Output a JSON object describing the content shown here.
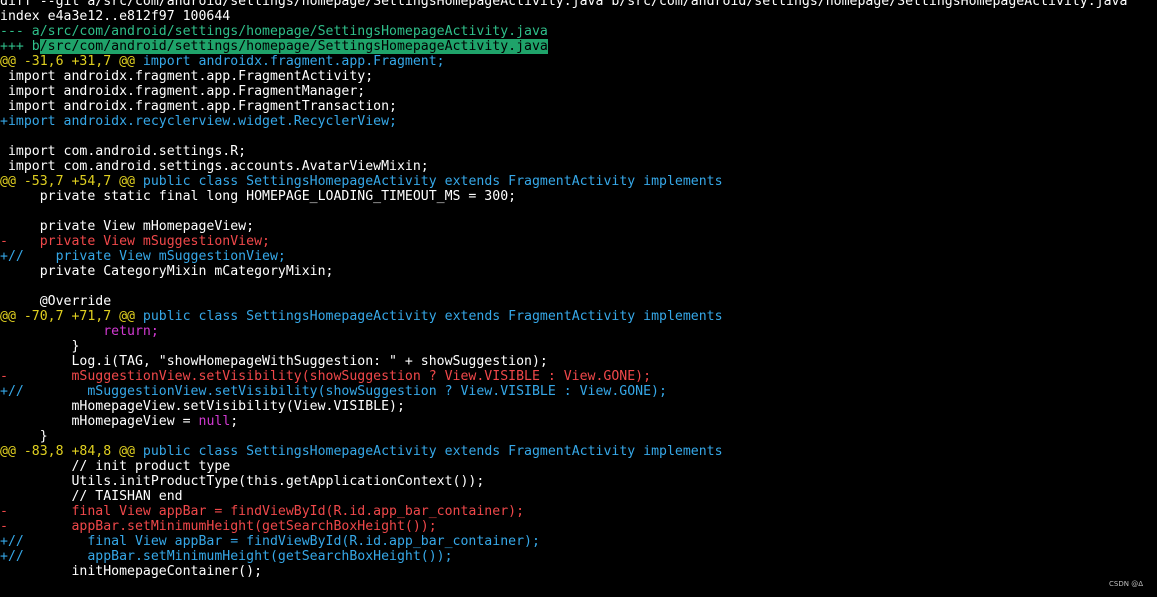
{
  "terminal": {
    "lines": [
      [
        [
          "diff --git a/src/com/android/settings/homepage/SettingsHomepageActivity.java b/src/com/android/settings/homepage/SettingsHomepageActivity.java",
          "white"
        ]
      ],
      [
        [
          "index e4a3e12..e812f97 100644",
          "white"
        ]
      ],
      [
        [
          "--- a",
          "green"
        ],
        [
          "/src/com/android/settings/homepage/SettingsHomepageActivity.java",
          "green"
        ]
      ],
      [
        [
          "+++ b",
          "green"
        ],
        [
          "/src/com/android/settings/homepage/SettingsHomepageActivity.java",
          "hl"
        ]
      ],
      [
        [
          "@@ -31,6 +31,7 @@",
          "yellow"
        ],
        [
          " import androidx.fragment.app.Fragment;",
          "cyan"
        ]
      ],
      [
        [
          " import androidx.fragment.app.FragmentActivity;",
          "white"
        ]
      ],
      [
        [
          " import androidx.fragment.app.FragmentManager;",
          "white"
        ]
      ],
      [
        [
          " import androidx.fragment.app.FragmentTransaction;",
          "white"
        ]
      ],
      [
        [
          "+import androidx.recyclerview.widget.RecyclerView;",
          "cyan"
        ]
      ],
      [
        [
          "",
          "white"
        ]
      ],
      [
        [
          " import com.android.settings.R;",
          "white"
        ]
      ],
      [
        [
          " import com.android.settings.accounts.AvatarViewMixin;",
          "white"
        ]
      ],
      [
        [
          "@@ -53,7 +54,7 @@",
          "yellow"
        ],
        [
          " public class ",
          "cyan"
        ],
        [
          "SettingsHomepageActivity",
          "cyan"
        ],
        [
          " extends ",
          "cyan"
        ],
        [
          "FragmentActivity",
          "cyan"
        ],
        [
          " implements",
          "cyan"
        ]
      ],
      [
        [
          "     private static final long HOMEPAGE_LOADING_TIMEOUT_MS = 300;",
          "white"
        ]
      ],
      [
        [
          "",
          "white"
        ]
      ],
      [
        [
          "     private View mHomepageView;",
          "white"
        ]
      ],
      [
        [
          "-    private View mSuggestionView;",
          "red"
        ]
      ],
      [
        [
          "+//    private View mSuggestionView;",
          "cyan"
        ]
      ],
      [
        [
          "     private CategoryMixin mCategoryMixin;",
          "white"
        ]
      ],
      [
        [
          "",
          "white"
        ]
      ],
      [
        [
          "     @Override",
          "white"
        ]
      ],
      [
        [
          "@@ -70,7 +71,7 @@",
          "yellow"
        ],
        [
          " public class ",
          "cyan"
        ],
        [
          "SettingsHomepageActivity",
          "cyan"
        ],
        [
          " extends ",
          "cyan"
        ],
        [
          "FragmentActivity",
          "cyan"
        ],
        [
          " implements",
          "cyan"
        ]
      ],
      [
        [
          "             ",
          "white"
        ],
        [
          "return;",
          "magenta"
        ]
      ],
      [
        [
          "         }",
          "white"
        ]
      ],
      [
        [
          "         Log.i(TAG, \"showHomepageWithSuggestion: \" + showSuggestion);",
          "white"
        ]
      ],
      [
        [
          "-        mSuggestionView.setVisibility(showSuggestion ? View.VISIBLE : View.GONE);",
          "red"
        ]
      ],
      [
        [
          "+//        mSuggestionView.setVisibility(showSuggestion ? View.VISIBLE : View.GONE);",
          "cyan"
        ]
      ],
      [
        [
          "         mHomepageView.setVisibility(View.VISIBLE);",
          "white"
        ]
      ],
      [
        [
          "         mHomepageView = ",
          "white"
        ],
        [
          "null",
          "magenta"
        ],
        [
          ";",
          "white"
        ]
      ],
      [
        [
          "     }",
          "white"
        ]
      ],
      [
        [
          "@@ -83,8 +84,8 @@",
          "yellow"
        ],
        [
          " public class ",
          "cyan"
        ],
        [
          "SettingsHomepageActivity",
          "cyan"
        ],
        [
          " extends ",
          "cyan"
        ],
        [
          "FragmentActivity",
          "cyan"
        ],
        [
          " implements",
          "cyan"
        ]
      ],
      [
        [
          "         // init product type",
          "white"
        ]
      ],
      [
        [
          "         Utils.initProductType(this.getApplicationContext());",
          "white"
        ]
      ],
      [
        [
          "         // TAISHAN end",
          "white"
        ]
      ],
      [
        [
          "-        final View appBar = findViewById(R.id.app_bar_container);",
          "red"
        ]
      ],
      [
        [
          "-        appBar.setMinimumHeight(getSearchBoxHeight());",
          "red"
        ]
      ],
      [
        [
          "+//        final View appBar = findViewById(R.id.app_bar_container);",
          "cyan"
        ]
      ],
      [
        [
          "+//        appBar.setMinimumHeight(getSearchBoxHeight());",
          "cyan"
        ]
      ],
      [
        [
          "         initHomepageContainer();",
          "white"
        ]
      ]
    ]
  },
  "watermark": "CSDN @Δ"
}
